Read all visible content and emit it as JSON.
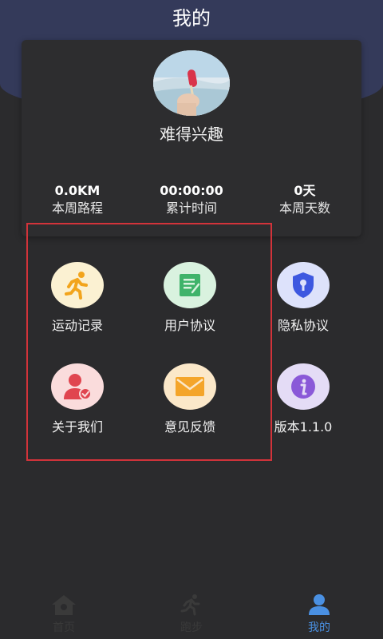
{
  "header": {
    "title": "我的"
  },
  "profile": {
    "nickname": "难得兴趣",
    "stats": [
      {
        "value": "0.0KM",
        "label": "本周路程"
      },
      {
        "value": "00:00:00",
        "label": "累计时间"
      },
      {
        "value": "0天",
        "label": "本周天数"
      }
    ]
  },
  "menu": [
    {
      "label": "运动记录",
      "icon": "running-icon",
      "bg": "#fbf1d2",
      "color": "#f2a41c"
    },
    {
      "label": "用户协议",
      "icon": "document-icon",
      "bg": "#d9f2df",
      "color": "#3fb36a"
    },
    {
      "label": "隐私协议",
      "icon": "shield-lock-icon",
      "bg": "#dde2fb",
      "color": "#3d58e0"
    },
    {
      "label": "关于我们",
      "icon": "user-check-icon",
      "bg": "#fadcdc",
      "color": "#e0454f"
    },
    {
      "label": "意见反馈",
      "icon": "envelope-icon",
      "bg": "#fbe8c9",
      "color": "#f4a52a"
    },
    {
      "label": "版本1.1.0",
      "icon": "info-icon",
      "bg": "#e4dcf6",
      "color": "#8a59d8"
    }
  ],
  "tabbar": {
    "items": [
      {
        "label": "首页",
        "icon": "home-icon"
      },
      {
        "label": "跑步",
        "icon": "running-icon"
      },
      {
        "label": "我的",
        "icon": "person-icon"
      }
    ],
    "active_index": 2,
    "active_color": "#4a90e2",
    "inactive_color": "#3a3a3a"
  }
}
